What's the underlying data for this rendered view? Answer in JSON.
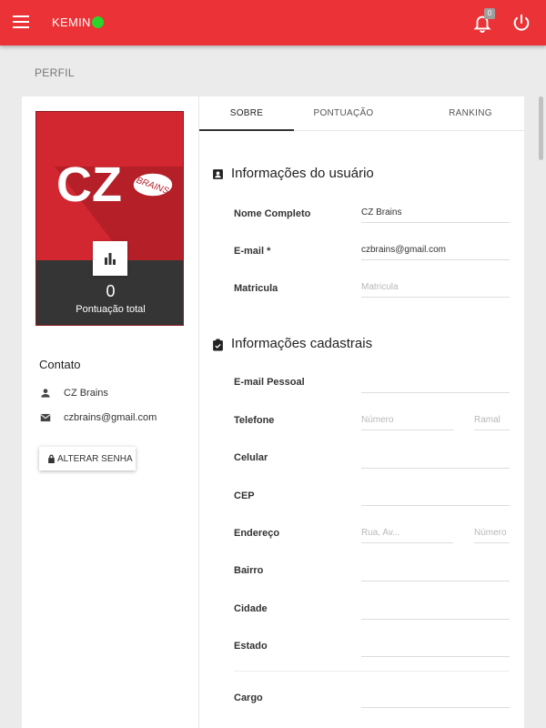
{
  "header": {
    "brand": "KEMIN",
    "status_color": "#2bd52b",
    "notification_count": "0",
    "accent_color": "#ea3237"
  },
  "page": {
    "title": "PERFIL"
  },
  "profile": {
    "score_value": "0",
    "score_label": "Pontuação total",
    "logo_text": "CZ",
    "logo_bubble_text": "BRAINS"
  },
  "contact": {
    "title": "Contato",
    "name": "CZ Brains",
    "email": "czbrains@gmail.com",
    "change_password_label": "ALTERAR SENHA"
  },
  "tabs": [
    {
      "label": "SOBRE",
      "active": true
    },
    {
      "label": "PONTUAÇÃO",
      "active": false
    },
    {
      "label": "RANKING",
      "active": false
    }
  ],
  "user_info": {
    "title": "Informações do usuário",
    "fields": [
      {
        "label": "Nome Completo",
        "value": "CZ Brains",
        "placeholder": ""
      },
      {
        "label": "E-mail *",
        "value": "czbrains@gmail.com",
        "placeholder": ""
      },
      {
        "label": "Matricula",
        "value": "",
        "placeholder": "Matricula"
      }
    ]
  },
  "registration": {
    "title": "Informações cadastrais",
    "email_personal": {
      "label": "E-mail Pessoal",
      "value": ""
    },
    "phone": {
      "label": "Telefone",
      "number_placeholder": "Número",
      "ext_placeholder": "Ramal"
    },
    "mobile": {
      "label": "Celular",
      "value": ""
    },
    "cep": {
      "label": "CEP",
      "value": ""
    },
    "address": {
      "label": "Endereço",
      "street_placeholder": "Rua, Av...",
      "number_placeholder": "Número"
    },
    "district": {
      "label": "Bairro",
      "value": ""
    },
    "city": {
      "label": "Cidade",
      "value": ""
    },
    "state": {
      "label": "Estado",
      "value": ""
    },
    "role": {
      "label": "Cargo",
      "value": ""
    }
  }
}
